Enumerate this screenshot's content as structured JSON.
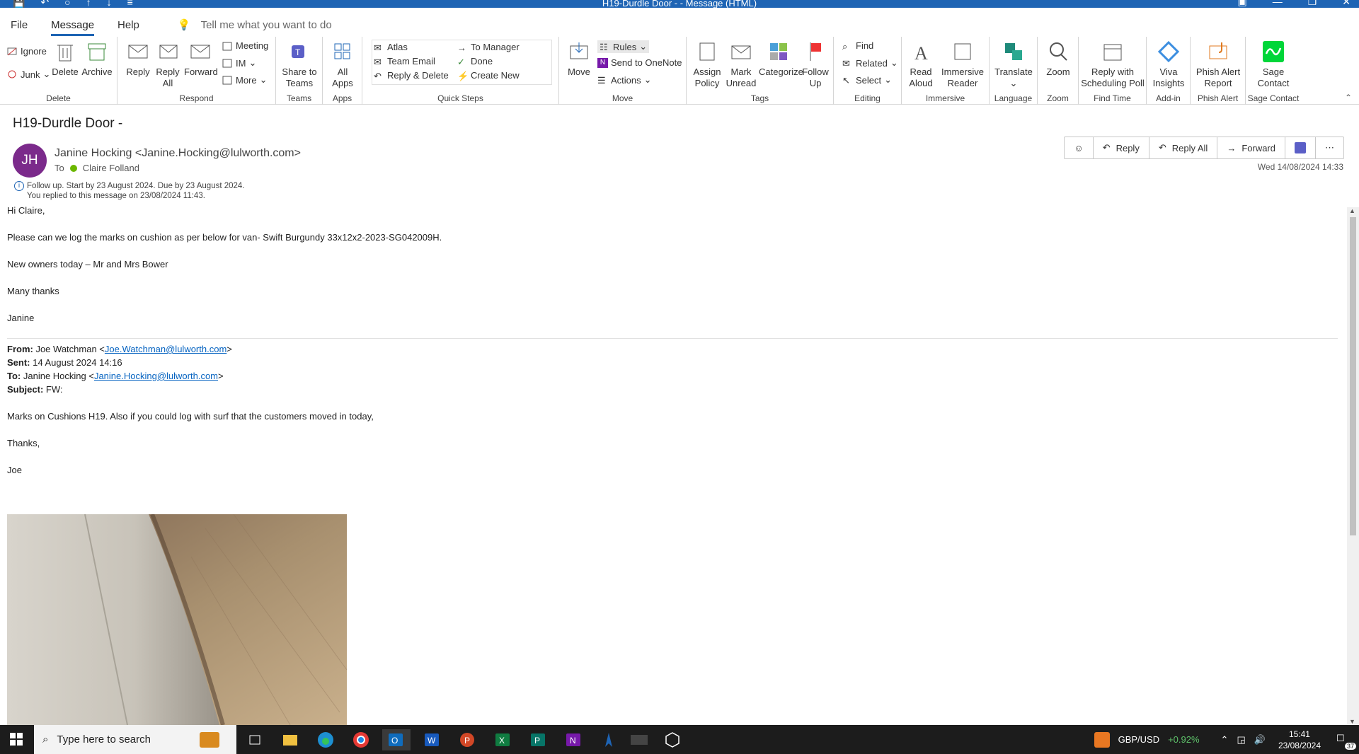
{
  "window": {
    "title": "H19-Durdle Door -  - Message (HTML)"
  },
  "menu": {
    "file": "File",
    "message": "Message",
    "help": "Help",
    "tellme": "Tell me what you want to do"
  },
  "ribbon": {
    "delete": {
      "ignore": "Ignore",
      "junk": "Junk",
      "delete": "Delete",
      "archive": "Archive",
      "label": "Delete"
    },
    "respond": {
      "reply": "Reply",
      "reply_all_1": "Reply",
      "reply_all_2": "All",
      "forward": "Forward",
      "meeting": "Meeting",
      "im": "IM",
      "more": "More",
      "label": "Respond"
    },
    "teams": {
      "share_1": "Share to",
      "share_2": "Teams",
      "label": "Teams"
    },
    "apps": {
      "all_1": "All",
      "all_2": "Apps",
      "label": "Apps"
    },
    "quicksteps": {
      "atlas": "Atlas",
      "team_email": "Team Email",
      "reply_delete": "Reply & Delete",
      "to_manager": "To Manager",
      "done": "Done",
      "create_new": "Create New",
      "label": "Quick Steps"
    },
    "move": {
      "move": "Move",
      "rules": "Rules",
      "onenote": "Send to OneNote",
      "actions": "Actions",
      "label": "Move"
    },
    "tags": {
      "assign_1": "Assign",
      "assign_2": "Policy",
      "mark_1": "Mark",
      "mark_2": "Unread",
      "categorize": "Categorize",
      "follow_1": "Follow",
      "follow_2": "Up",
      "label": "Tags"
    },
    "editing": {
      "find": "Find",
      "related": "Related",
      "select": "Select",
      "label": "Editing"
    },
    "immersive": {
      "read_1": "Read",
      "read_2": "Aloud",
      "reader_1": "Immersive",
      "reader_2": "Reader",
      "label": "Immersive"
    },
    "language": {
      "translate": "Translate",
      "label": "Language"
    },
    "zoom": {
      "zoom": "Zoom",
      "label": "Zoom"
    },
    "findtime": {
      "reply_1": "Reply with",
      "reply_2": "Scheduling Poll",
      "label": "Find Time"
    },
    "addin": {
      "viva_1": "Viva",
      "viva_2": "Insights",
      "label": "Add-in"
    },
    "phish": {
      "phish_1": "Phish Alert",
      "phish_2": "Report",
      "label": "Phish Alert"
    },
    "sage": {
      "sage_1": "Sage",
      "sage_2": "Contact",
      "label": "Sage Contact"
    }
  },
  "message": {
    "subject": "H19-Durdle Door -",
    "initials": "JH",
    "sender": "Janine Hocking <Janine.Hocking@lulworth.com>",
    "to_label": "To",
    "to": "Claire Folland",
    "followup": "Follow up.  Start by 23 August 2024.  Due by 23 August 2024.",
    "replied": "You replied to this message on 23/08/2024 11:43.",
    "actions": {
      "reply": "Reply",
      "reply_all": "Reply All",
      "forward": "Forward"
    },
    "date": "Wed 14/08/2024 14:33"
  },
  "body": {
    "greeting": "Hi Claire,",
    "line1": "Please can we log the marks on cushion as per below for van- Swift Burgundy 33x12x2-2023-SG042009H.",
    "line2": "New owners today – Mr and Mrs Bower",
    "line3": "Many thanks",
    "sign": "Janine",
    "fwd": {
      "from_label": "From:",
      "from_name": " Joe Watchman <",
      "from_email": "Joe.Watchman@lulworth.com",
      "from_end": ">",
      "sent_label": "Sent:",
      "sent": " 14 August 2024 14:16",
      "to_label": "To:",
      "to_name": " Janine Hocking <",
      "to_email": "Janine.Hocking@lulworth.com",
      "to_end": ">",
      "subject_label": "Subject:",
      "subject": " FW:"
    },
    "fwd_line1": "Marks on Cushions H19. Also if you could log with surf that the customers moved in today,",
    "fwd_thanks": "Thanks,",
    "fwd_sign": "Joe"
  },
  "taskbar": {
    "search": "Type here to search",
    "currency": "GBP/USD",
    "change": "+0.92%",
    "time": "15:41",
    "date": "23/08/2024",
    "notif": "37"
  }
}
